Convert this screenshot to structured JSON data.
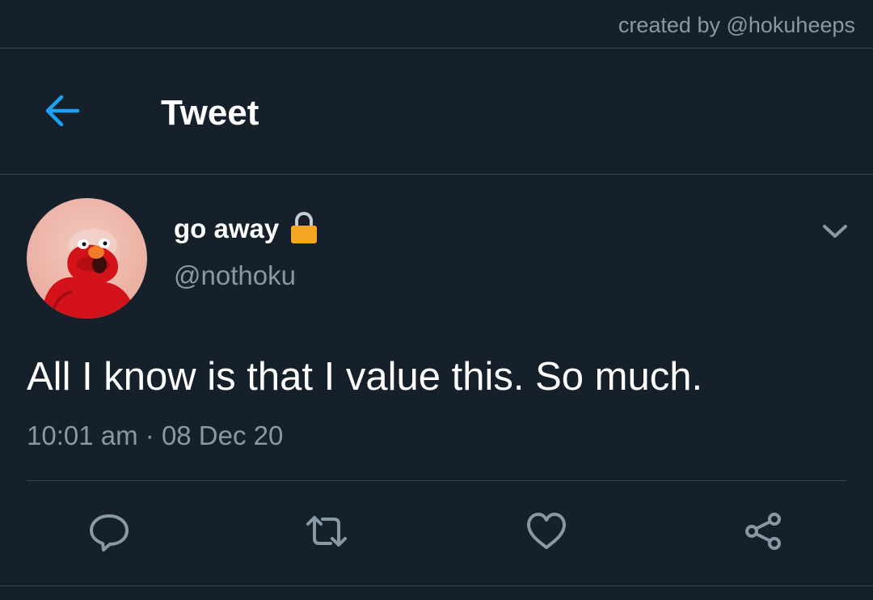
{
  "credit": "created by @hokuheeps",
  "header": {
    "title": "Tweet",
    "back_icon": "arrow-left-icon"
  },
  "tweet": {
    "display_name": "go away",
    "handle": "@nothoku",
    "protected_icon": "lock-icon",
    "text": "All I know is that I value this. So much.",
    "time": "10:01 am",
    "separator": "·",
    "date": "08 Dec 20"
  },
  "actions": [
    {
      "icon": "reply-icon"
    },
    {
      "icon": "retweet-icon"
    },
    {
      "icon": "like-icon"
    },
    {
      "icon": "share-icon"
    }
  ],
  "colors": {
    "background": "#15202b",
    "accent": "#1da1f2",
    "secondary_text": "#8899a6",
    "divider": "#38444d",
    "lock": "#f5a623"
  }
}
